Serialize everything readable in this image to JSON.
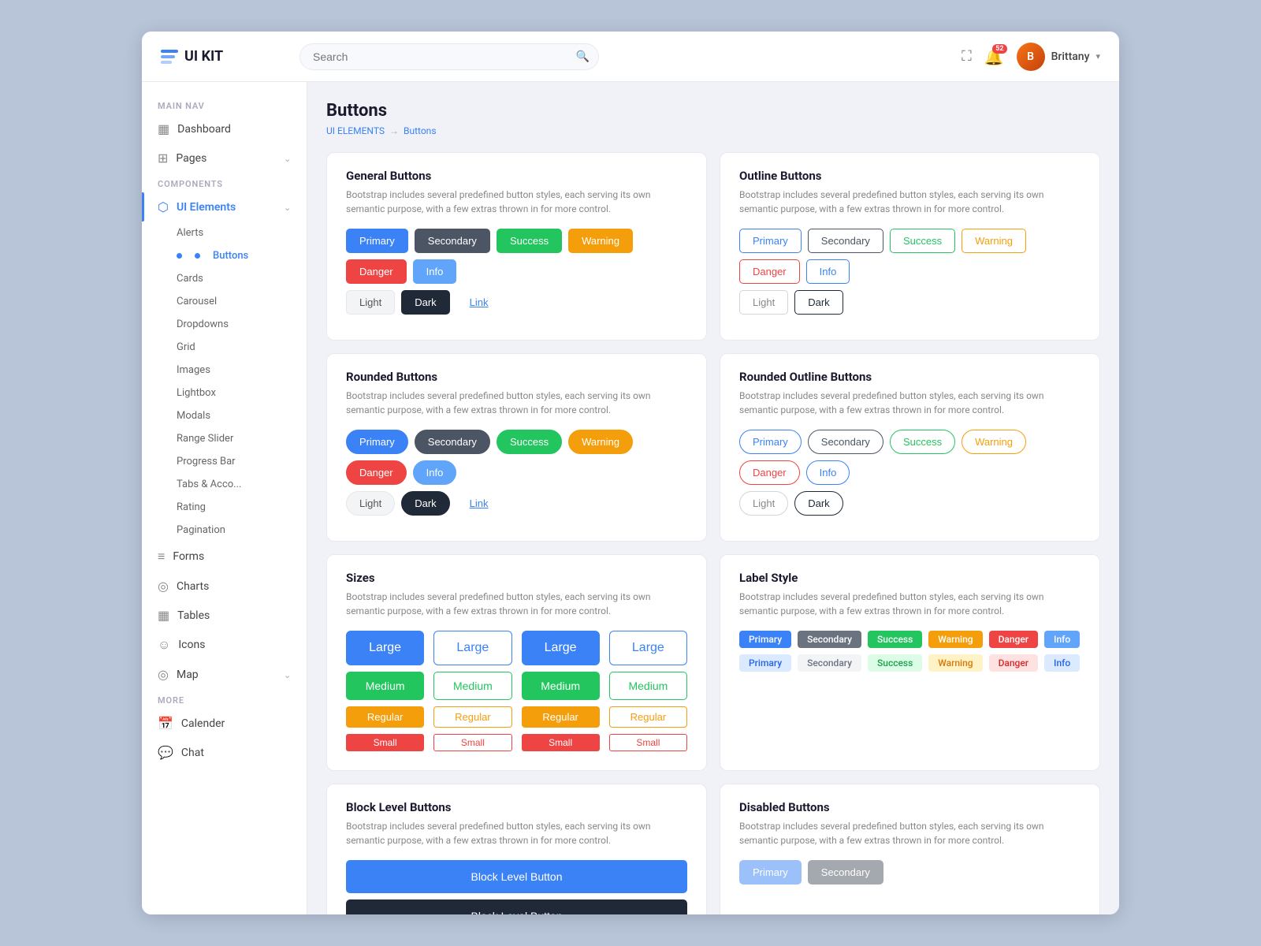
{
  "header": {
    "logo_text": "UI KIT",
    "search_placeholder": "Search",
    "notif_count": "52",
    "user_name": "Brittany",
    "user_initials": "B"
  },
  "sidebar": {
    "main_nav_label": "Main Nav",
    "items": [
      {
        "id": "dashboard",
        "label": "Dashboard",
        "icon": "📊"
      },
      {
        "id": "pages",
        "label": "Pages",
        "icon": "📄",
        "has_arrow": true
      }
    ],
    "components_label": "Components",
    "components_items": [
      {
        "id": "ui-elements",
        "label": "UI Elements",
        "icon": "🧩",
        "active": true,
        "has_arrow": true
      },
      {
        "id": "alerts",
        "label": "Alerts"
      },
      {
        "id": "buttons",
        "label": "Buttons",
        "active_sub": true
      },
      {
        "id": "cards",
        "label": "Cards"
      },
      {
        "id": "carousel",
        "label": "Carousel"
      },
      {
        "id": "dropdowns",
        "label": "Dropdowns"
      },
      {
        "id": "grid",
        "label": "Grid"
      },
      {
        "id": "images",
        "label": "Images"
      },
      {
        "id": "lightbox",
        "label": "Lightbox"
      },
      {
        "id": "modals",
        "label": "Modals"
      },
      {
        "id": "range-slider",
        "label": "Range Slider"
      },
      {
        "id": "progress-bar",
        "label": "Progress Bar"
      },
      {
        "id": "tabs-accordion",
        "label": "Tabs & Acco..."
      },
      {
        "id": "rating",
        "label": "Rating"
      },
      {
        "id": "pagination",
        "label": "Pagination"
      }
    ],
    "forms_label": "Forms",
    "more_items": [
      {
        "id": "forms",
        "label": "Forms",
        "icon": "📝"
      },
      {
        "id": "charts",
        "label": "Charts",
        "icon": "📈"
      },
      {
        "id": "tables",
        "label": "Tables",
        "icon": "📋"
      },
      {
        "id": "icons",
        "label": "Icons",
        "icon": "😊"
      },
      {
        "id": "map",
        "label": "Map",
        "icon": "📍",
        "has_arrow": true
      }
    ],
    "more_label": "More",
    "more_nav": [
      {
        "id": "calendar",
        "label": "Calender",
        "icon": "📅"
      },
      {
        "id": "chat",
        "label": "Chat",
        "icon": "💬"
      }
    ]
  },
  "page": {
    "title": "Buttons",
    "breadcrumb_parent": "UI ELEMENTS",
    "breadcrumb_current": "Buttons"
  },
  "general_buttons": {
    "title": "General Buttons",
    "desc": "Bootstrap includes several predefined button styles, each serving its own semantic purpose, with a few extras thrown in for more control.",
    "row1": [
      "Primary",
      "Secondary",
      "Success",
      "Warning",
      "Danger",
      "Info"
    ],
    "row2": [
      "Light",
      "Dark",
      "Link"
    ]
  },
  "outline_buttons": {
    "title": "Outline Buttons",
    "desc": "Bootstrap includes several predefined button styles, each serving its own semantic purpose, with a few extras thrown in for more control.",
    "row1": [
      "Primary",
      "Secondary",
      "Success",
      "Warning",
      "Danger",
      "Info"
    ],
    "row2": [
      "Light",
      "Dark"
    ]
  },
  "rounded_buttons": {
    "title": "Rounded Buttons",
    "desc": "Bootstrap includes several predefined button styles, each serving its own semantic purpose, with a few extras thrown in for more control.",
    "row1": [
      "Primary",
      "Secondary",
      "Success",
      "Warning",
      "Danger",
      "Info"
    ],
    "row2": [
      "Light",
      "Dark",
      "Link"
    ]
  },
  "rounded_outline_buttons": {
    "title": "Rounded Outline Buttons",
    "desc": "Bootstrap includes several predefined button styles, each serving its own semantic purpose, with a few extras thrown in for more control.",
    "row1": [
      "Primary",
      "Secondary",
      "Success",
      "Warning",
      "Danger",
      "Info"
    ],
    "row2": [
      "Light",
      "Dark"
    ]
  },
  "sizes": {
    "title": "Sizes",
    "desc": "Bootstrap includes several predefined button styles, each serving its own semantic purpose, with a few extras thrown in for more control.",
    "col1_labels": [
      "Large",
      "Medium",
      "Regular",
      "Small"
    ],
    "col1_type": "filled-primary-warning-danger",
    "sizes": [
      "Large",
      "Medium",
      "Regular",
      "Small"
    ]
  },
  "label_style": {
    "title": "Label Style",
    "desc": "Bootstrap includes several predefined button styles, each serving its own semantic purpose, with a few extras thrown in for more control.",
    "row1": [
      "Primary",
      "Secondary",
      "Success",
      "Warning",
      "Danger",
      "Info"
    ],
    "row2": [
      "Primary",
      "Secondary",
      "Success",
      "Warning",
      "Danger",
      "Info"
    ]
  },
  "block_level": {
    "title": "Block Level Buttons",
    "desc": "Bootstrap includes several predefined button styles, each serving its own semantic purpose, with a few extras thrown in for more control.",
    "btn1": "Block Level Button",
    "btn2": "Block Level Button"
  },
  "disabled_buttons": {
    "title": "Disabled Buttons",
    "desc": "Bootstrap includes several predefined button styles, each serving its own semantic purpose, with a few extras thrown in for more control.",
    "buttons": [
      "Primary",
      "Secondary"
    ]
  }
}
